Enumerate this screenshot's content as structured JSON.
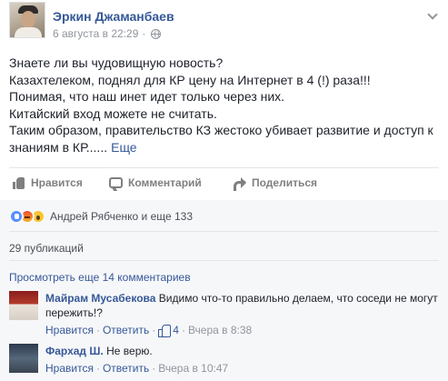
{
  "post": {
    "author": "Эркин Джаманбаев",
    "timestamp": "6 августа в 22:29",
    "privacy_icon": "globe-icon",
    "menu_icon": "chevron-down-icon",
    "text_lines": [
      "Знаете ли вы чудовищную новость?",
      "Казахтелеком, поднял для КР цену на Интернет в 4 (!) раза!!!",
      "Понимая, что наш инет идет только через них.",
      "Китайский вход можете не считать.",
      "Таким образом, правительство КЗ жестоко убивает развитие и доступ к",
      "знаниям в КР......"
    ],
    "more_label": "Еще"
  },
  "actions": {
    "like_label": "Нравится",
    "comment_label": "Комментарий",
    "share_label": "Поделиться"
  },
  "feedback": {
    "reactions_text": "Андрей Рябченко и еще 133",
    "shares_text": "29 публикаций",
    "view_more": "Просмотреть еще 14 комментариев"
  },
  "comments": [
    {
      "name": "Майрам Мусабекова",
      "text": "Видимо что-то правильно делаем, что соседи не могут пережить!?",
      "like_link": "Нравится",
      "reply_link": "Ответить",
      "like_count": "4",
      "time": "Вчера в 8:38"
    },
    {
      "name": "Фархад Ш.",
      "text": "Не верю.",
      "like_link": "Нравится",
      "reply_link": "Ответить",
      "time": "Вчера в 10:47"
    }
  ],
  "colors": {
    "link": "#365899",
    "meta": "#90949c",
    "feedback_bg": "#f6f7f9",
    "like_reaction": "#5890ff"
  }
}
